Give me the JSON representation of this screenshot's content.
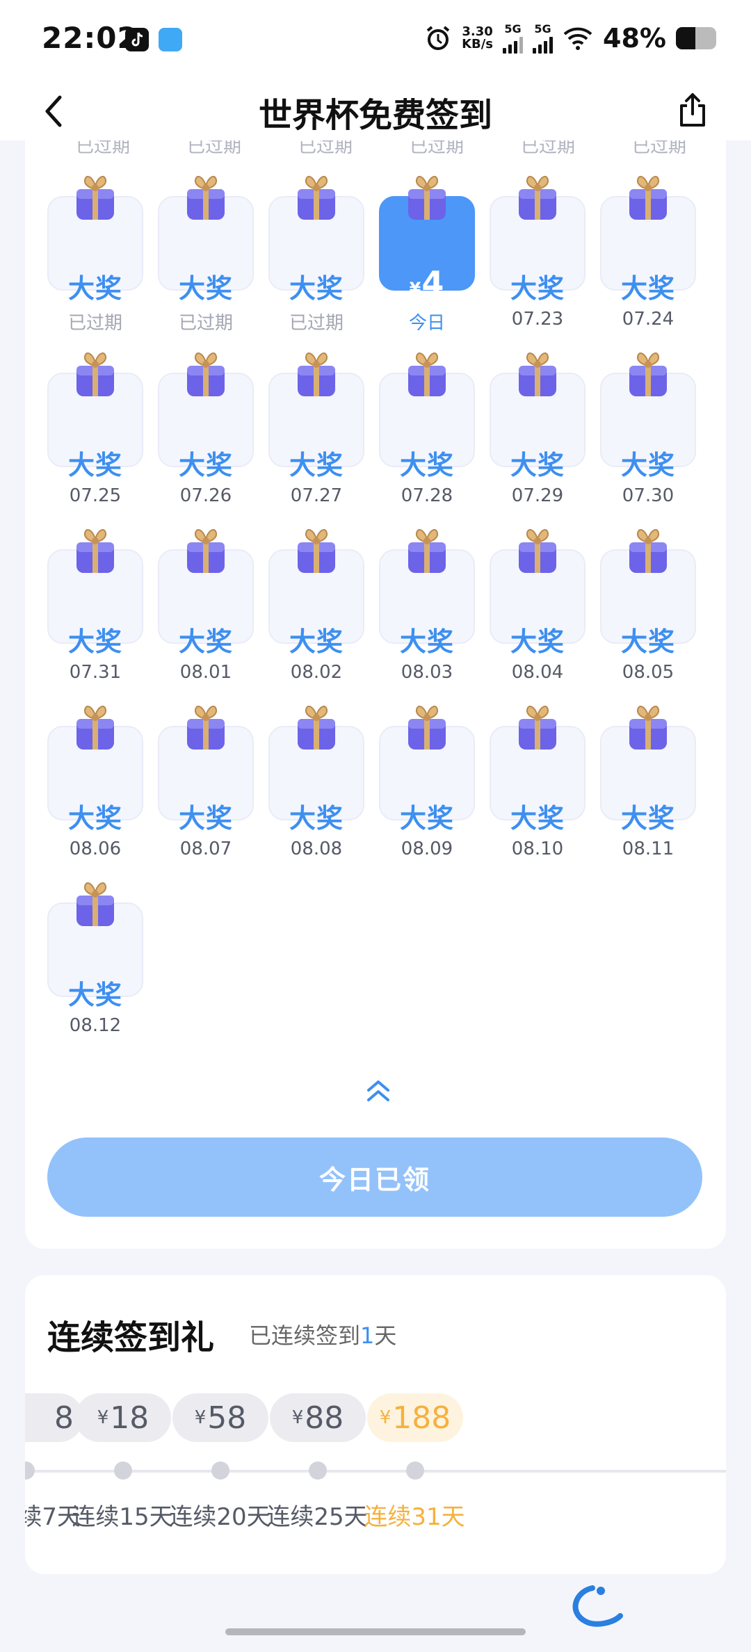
{
  "status_bar": {
    "time": "22:02",
    "net_speed_value": "3.30",
    "net_speed_unit": "KB/s",
    "sim1": "5G",
    "sim2": "5G",
    "battery_text": "48%",
    "battery_level": 0.48
  },
  "nav": {
    "title": "世界杯免费签到",
    "back_icon": "chevron-left-icon",
    "share_icon": "share-icon"
  },
  "calendar": {
    "cut_labels": [
      "已过期",
      "已过期",
      "已过期",
      "已过期",
      "已过期",
      "已过期"
    ],
    "days": [
      {
        "prize": "大奖",
        "date": "已过期",
        "status": "expired"
      },
      {
        "prize": "大奖",
        "date": "已过期",
        "status": "expired"
      },
      {
        "prize": "大奖",
        "date": "已过期",
        "status": "expired"
      },
      {
        "prize_symbol": "¥",
        "prize": "4",
        "date": "今日",
        "status": "today"
      },
      {
        "prize": "大奖",
        "date": "07.23",
        "status": "future"
      },
      {
        "prize": "大奖",
        "date": "07.24",
        "status": "future"
      },
      {
        "prize": "大奖",
        "date": "07.25",
        "status": "future"
      },
      {
        "prize": "大奖",
        "date": "07.26",
        "status": "future"
      },
      {
        "prize": "大奖",
        "date": "07.27",
        "status": "future"
      },
      {
        "prize": "大奖",
        "date": "07.28",
        "status": "future"
      },
      {
        "prize": "大奖",
        "date": "07.29",
        "status": "future"
      },
      {
        "prize": "大奖",
        "date": "07.30",
        "status": "future"
      },
      {
        "prize": "大奖",
        "date": "07.31",
        "status": "future"
      },
      {
        "prize": "大奖",
        "date": "08.01",
        "status": "future"
      },
      {
        "prize": "大奖",
        "date": "08.02",
        "status": "future"
      },
      {
        "prize": "大奖",
        "date": "08.03",
        "status": "future"
      },
      {
        "prize": "大奖",
        "date": "08.04",
        "status": "future"
      },
      {
        "prize": "大奖",
        "date": "08.05",
        "status": "future"
      },
      {
        "prize": "大奖",
        "date": "08.06",
        "status": "future"
      },
      {
        "prize": "大奖",
        "date": "08.07",
        "status": "future"
      },
      {
        "prize": "大奖",
        "date": "08.08",
        "status": "future"
      },
      {
        "prize": "大奖",
        "date": "08.09",
        "status": "future"
      },
      {
        "prize": "大奖",
        "date": "08.10",
        "status": "future"
      },
      {
        "prize": "大奖",
        "date": "08.11",
        "status": "future"
      },
      {
        "prize": "大奖",
        "date": "08.12",
        "status": "future"
      }
    ],
    "collapse_icon": "double-chevron-up-icon",
    "claim_button": "今日已领"
  },
  "streak": {
    "title": "连续签到礼",
    "subtitle_prefix": "已连续签到",
    "subtitle_count": "1",
    "subtitle_suffix": "天",
    "milestones": [
      {
        "symbol": "",
        "amount": "8",
        "label": "续7天",
        "highlight": false
      },
      {
        "symbol": "¥",
        "amount": "18",
        "label": "连续15天",
        "highlight": false
      },
      {
        "symbol": "¥",
        "amount": "58",
        "label": "连续20天",
        "highlight": false
      },
      {
        "symbol": "¥",
        "amount": "88",
        "label": "连续25天",
        "highlight": false
      },
      {
        "symbol": "¥",
        "amount": "188",
        "label": "连续31天",
        "highlight": true
      }
    ]
  },
  "colors": {
    "accent": "#3d8ff0",
    "today_tile": "#4c97f7",
    "claim_button": "#93c2fb",
    "gold": "#f5b13d"
  }
}
